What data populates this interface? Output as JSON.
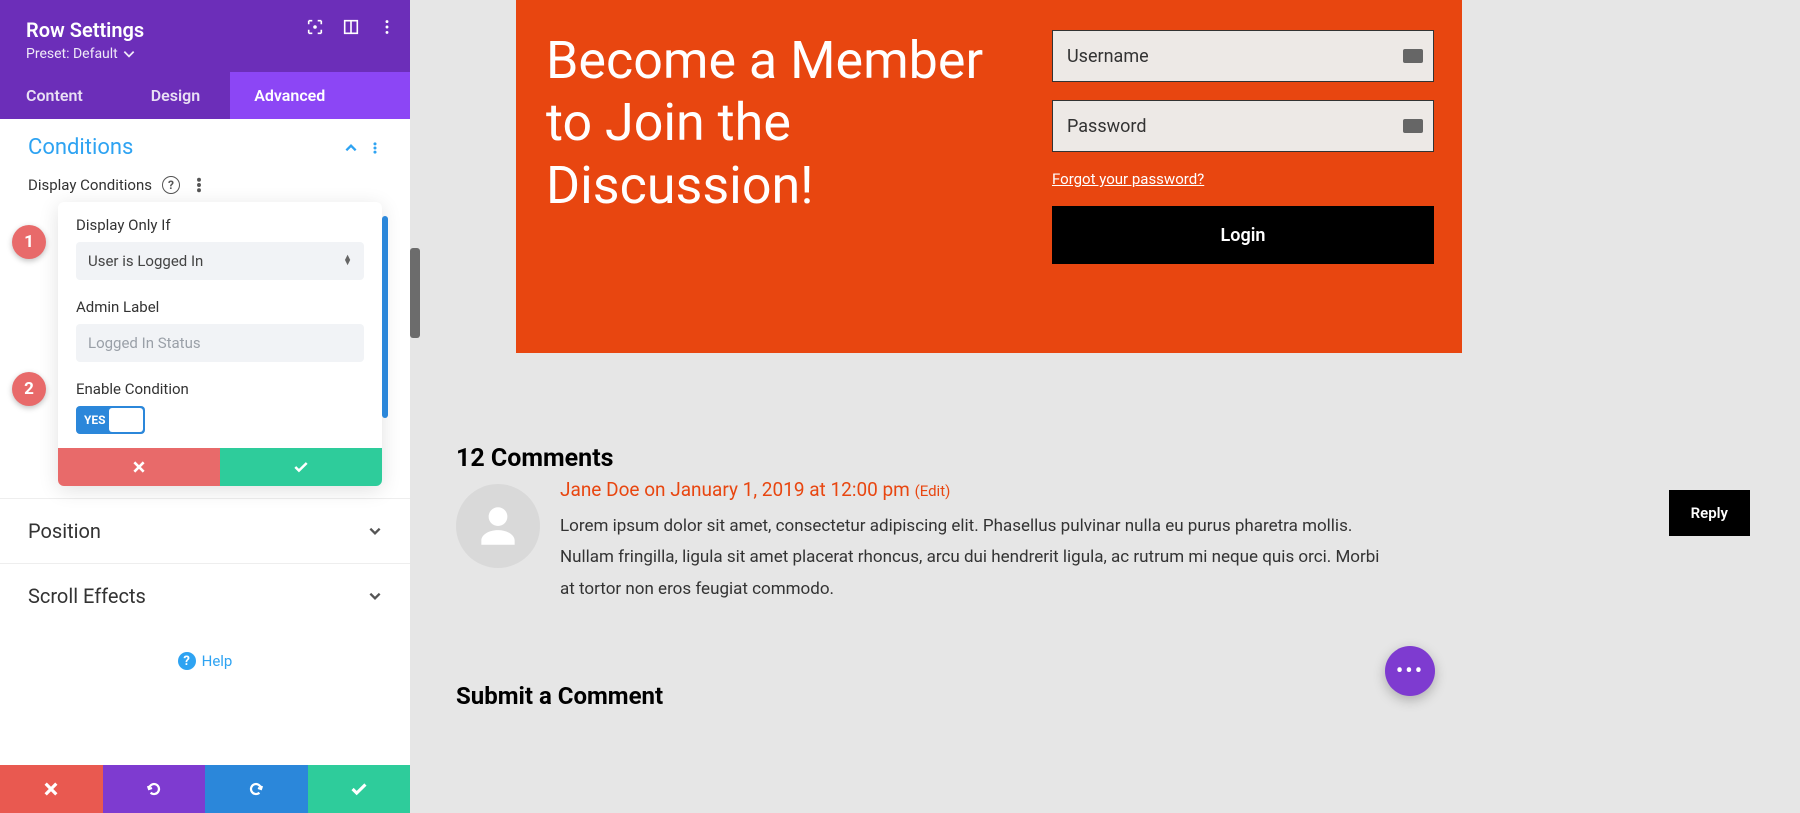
{
  "panel": {
    "title": "Row Settings",
    "preset": "Preset: Default",
    "tabs": [
      "Content",
      "Design",
      "Advanced"
    ],
    "active_tab": 2
  },
  "conditions": {
    "section_title": "Conditions",
    "display_conditions_label": "Display Conditions",
    "card": {
      "display_only_if_label": "Display Only If",
      "display_only_if_value": "User is Logged In",
      "admin_label_label": "Admin Label",
      "admin_label_placeholder": "Logged In Status",
      "enable_condition_label": "Enable Condition",
      "enable_condition_value": "YES"
    }
  },
  "sections": {
    "position": "Position",
    "scroll_effects": "Scroll Effects"
  },
  "help_label": "Help",
  "badges": {
    "one": "1",
    "two": "2"
  },
  "cta": {
    "title": "Become a Member to Join the Discussion!",
    "username_placeholder": "Username",
    "password_placeholder": "Password",
    "forgot": "Forgot your password?",
    "login": "Login"
  },
  "comments": {
    "count_label": "12 Comments",
    "author": "Jane Doe",
    "meta_rest": " on January 1, 2019 at 12:00 pm ",
    "edit": "(Edit)",
    "body": "Lorem ipsum dolor sit amet, consectetur adipiscing elit. Phasellus pulvinar nulla eu purus pharetra mollis. Nullam fringilla, ligula sit amet placerat rhoncus, arcu dui hendrerit ligula, ac rutrum mi neque quis orci. Morbi at tortor non eros feugiat commodo.",
    "reply": "Reply",
    "submit_title": "Submit a Comment"
  },
  "colors": {
    "brand_purple": "#6c2eb9",
    "brand_orange": "#e84610",
    "accent_blue": "#2b87da",
    "accent_teal": "#2ecc9b",
    "danger": "#e86a6a"
  }
}
